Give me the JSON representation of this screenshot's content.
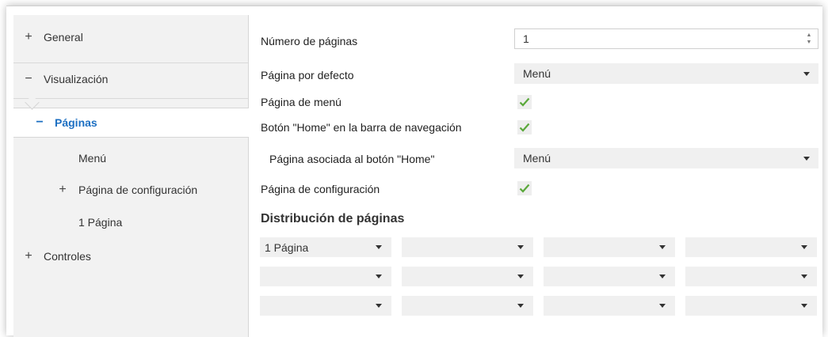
{
  "sidebar": {
    "items": [
      {
        "sign": "+",
        "label": "General"
      },
      {
        "sign": "−",
        "label": "Visualización"
      },
      {
        "sign": "−",
        "label": "Páginas"
      },
      {
        "sign": "",
        "label": "Menú"
      },
      {
        "sign": "+",
        "label": "Página de configuración"
      },
      {
        "sign": "",
        "label": "1 Página"
      },
      {
        "sign": "+",
        "label": "Controles"
      }
    ]
  },
  "main": {
    "num_pages_label": "Número de páginas",
    "num_pages_value": "1",
    "default_page_label": "Página por defecto",
    "default_page_value": "Menú",
    "menu_page_label": "Página de menú",
    "home_button_label": "Botón \"Home\" en la barra de navegación",
    "home_page_label": "Página asociada al botón \"Home\"",
    "home_page_value": "Menú",
    "config_page_label": "Página de configuración",
    "distribution_title": "Distribución de páginas",
    "grid": [
      [
        "1 Página",
        "",
        "",
        ""
      ],
      [
        "",
        "",
        "",
        ""
      ],
      [
        "",
        "",
        "",
        ""
      ]
    ]
  },
  "colors": {
    "accent": "#1c6fc2",
    "check": "#5aa83a",
    "sidebar_bg": "#f2f2f2",
    "field_bg": "#f0f0f0"
  }
}
